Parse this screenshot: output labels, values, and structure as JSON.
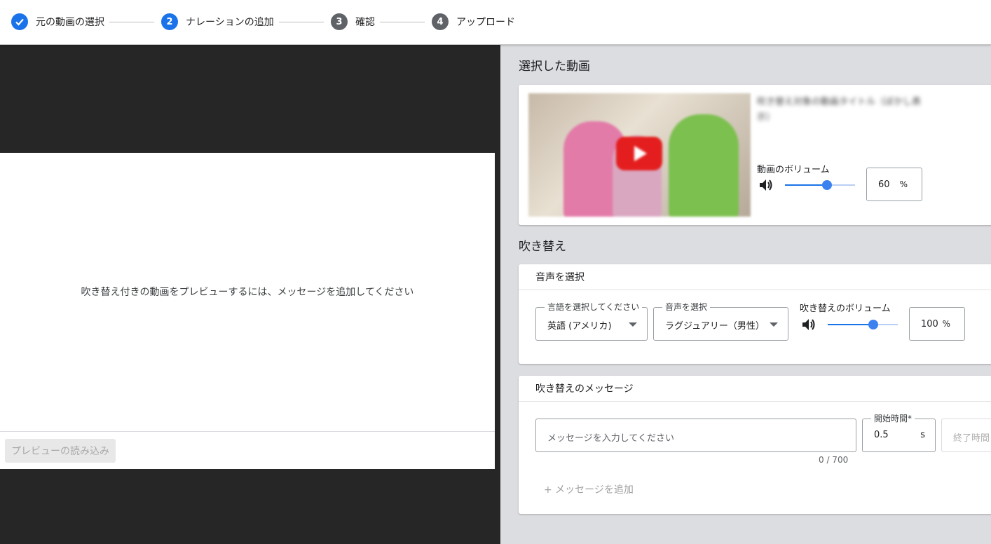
{
  "stepper": {
    "steps": [
      {
        "number": "✓",
        "label": "元の動画の選択",
        "state": "done"
      },
      {
        "number": "2",
        "label": "ナレーションの追加",
        "state": "active"
      },
      {
        "number": "3",
        "label": "確認",
        "state": "todo"
      },
      {
        "number": "4",
        "label": "アップロード",
        "state": "todo"
      }
    ]
  },
  "preview": {
    "message": "吹き替え付きの動画をプレビューするには、メッセージを追加してください",
    "load_button": "プレビューの読み込み"
  },
  "selected_video": {
    "section_title": "選択した動画",
    "title_blurred": "吹き替え対象の動画タイトル（ぼかし表示）",
    "volume_label": "動画のボリューム",
    "volume_value": "60",
    "volume_fraction": 0.6,
    "volume_unit": "%"
  },
  "dubbing": {
    "section_title": "吹き替え",
    "voice_card_title": "音声を選択",
    "language_legend": "言語を選択してください",
    "language_value": "英語 (アメリカ)",
    "voice_legend": "音声を選択",
    "voice_value": "ラグジュアリー（男性）",
    "volume_label": "吹き替えのボリューム",
    "volume_value": "100",
    "volume_fraction": 0.65,
    "volume_unit": "%"
  },
  "messages": {
    "card_title": "吹き替えのメッセージ",
    "input_placeholder": "メッセージを入力してください",
    "char_counter": "0 / 700",
    "start_time_legend": "開始時間*",
    "start_time_value": "0.5",
    "start_time_unit": "s",
    "end_time_placeholder": "終了時間",
    "add_message": "+ メッセージを追加"
  },
  "colors": {
    "accent": "#1a73e8",
    "step_todo": "#5f6368",
    "left_background": "#262626",
    "right_background": "#dcdde0"
  }
}
